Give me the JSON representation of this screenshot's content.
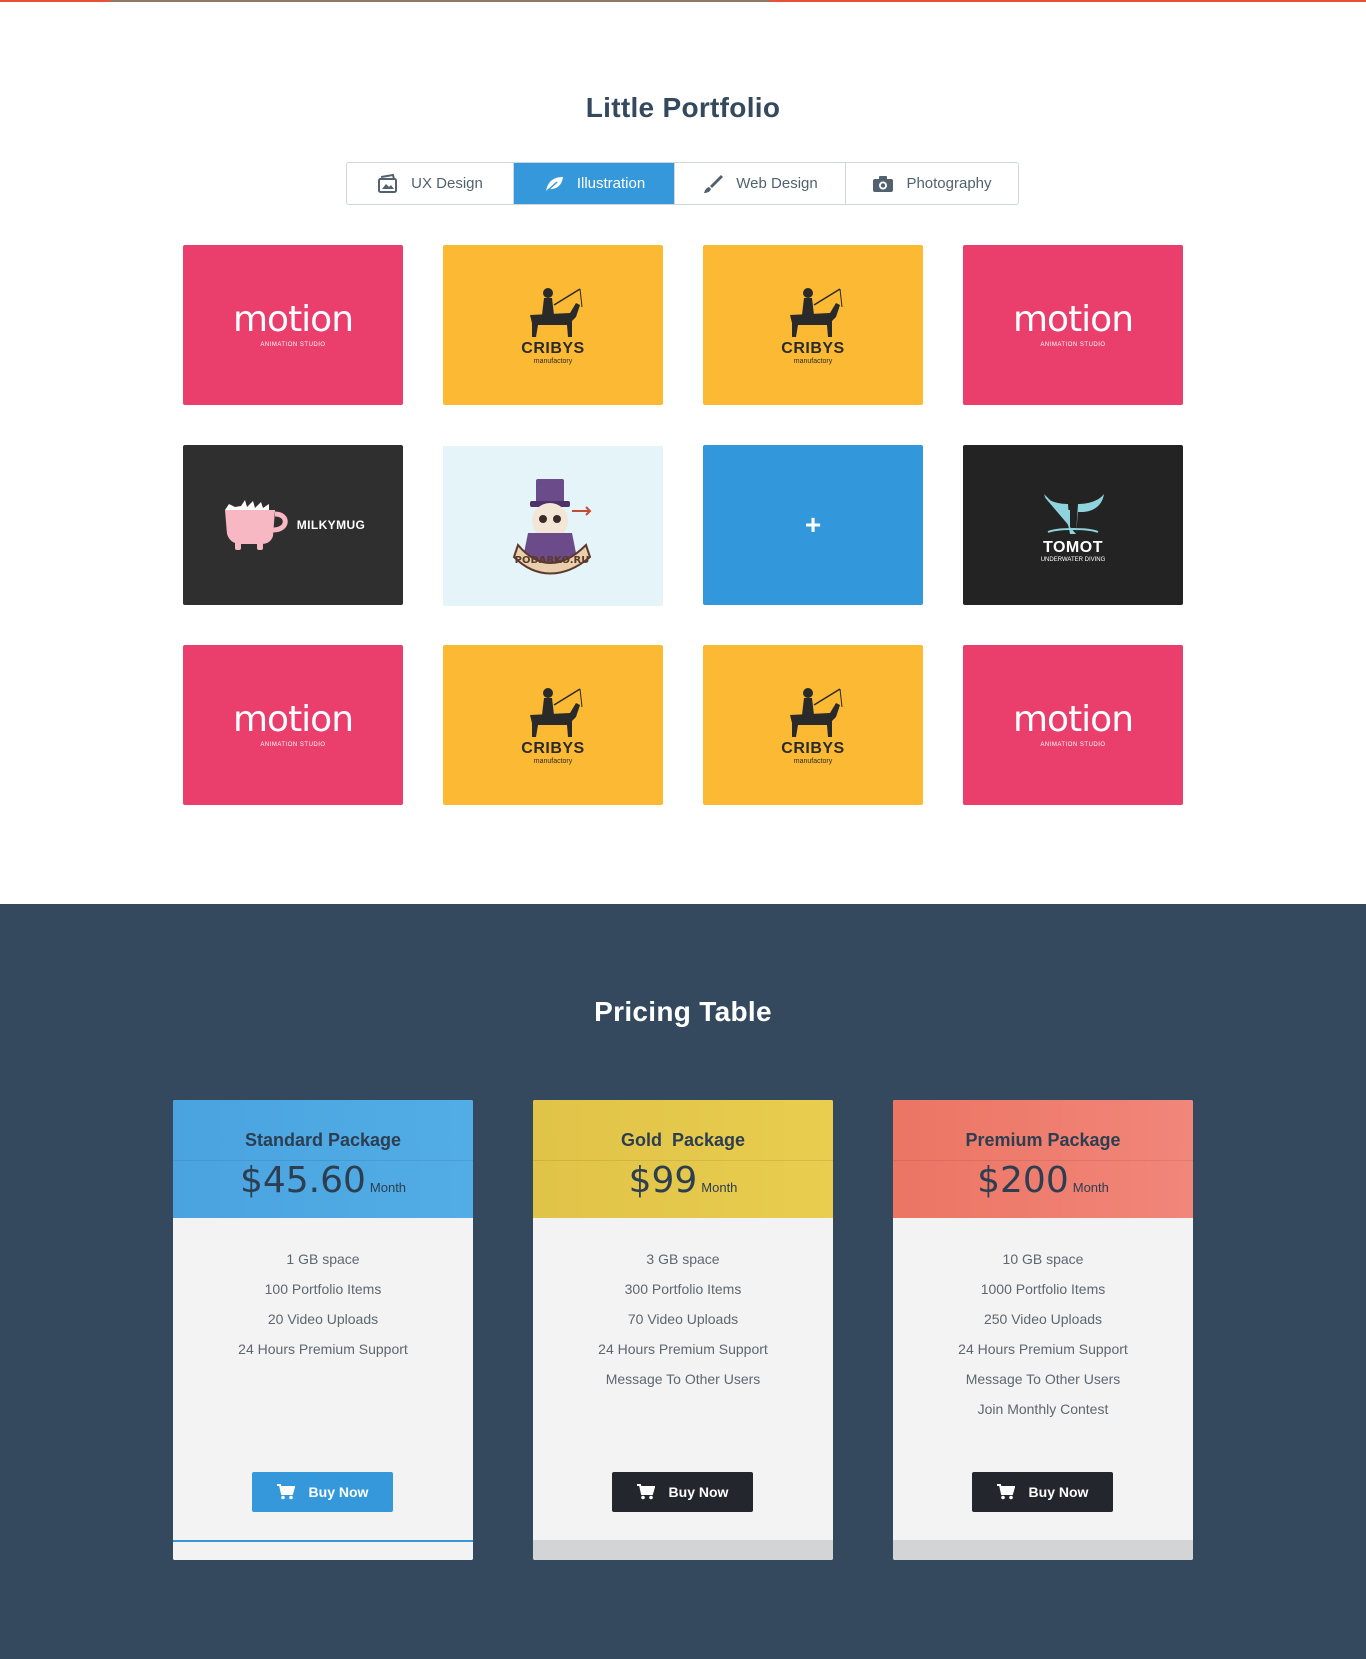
{
  "portfolio": {
    "title": "Little Portfolio",
    "filters": [
      {
        "label": "UX Design",
        "icon": "image-folder-icon",
        "active": false
      },
      {
        "label": "Illustration",
        "icon": "leaf-icon",
        "active": true
      },
      {
        "label": "Web Design",
        "icon": "brush-icon",
        "active": false
      },
      {
        "label": "Photography",
        "icon": "camera-icon",
        "active": false
      }
    ],
    "tiles": [
      {
        "logo": "motion",
        "color": "#ea3e6c"
      },
      {
        "logo": "cribys",
        "color": "#fbb934"
      },
      {
        "logo": "cribys",
        "color": "#fbb934"
      },
      {
        "logo": "motion",
        "color": "#ea3e6c"
      },
      {
        "logo": "milkymug",
        "color": "#2f2f2f"
      },
      {
        "logo": "podarko",
        "color": "#e4f4f9"
      },
      {
        "logo": "plus",
        "color": "#3398db"
      },
      {
        "logo": "tomot",
        "color": "#232323"
      },
      {
        "logo": "motion",
        "color": "#ea3e6c"
      },
      {
        "logo": "cribys",
        "color": "#fbb934"
      },
      {
        "logo": "cribys",
        "color": "#fbb934"
      },
      {
        "logo": "motion",
        "color": "#ea3e6c"
      }
    ],
    "motion": {
      "word": "motion",
      "sub": "ANIMATION STUDIO"
    },
    "cribys": {
      "word": "CRIBYS",
      "sub": "manufactory"
    },
    "milkymug": {
      "word": "MILKYMUG"
    },
    "podarko": {
      "word": "PODARKO.RU"
    },
    "plus": {
      "symbol": "+"
    },
    "tomot": {
      "word": "TOMOT",
      "sub": "UNDERWATER DIVING"
    }
  },
  "pricing": {
    "title": "Pricing Table",
    "packages": [
      {
        "name": "Standard Package",
        "price": "$45.60",
        "period": "Month",
        "header_color": "#4aa3df",
        "button_style": "blue",
        "features": [
          "1 GB space",
          "100 Portfolio Items",
          "20 Video Uploads",
          "24 Hours Premium Support"
        ],
        "button_label": "Buy Now"
      },
      {
        "name": "Gold  Package",
        "price": "$99",
        "period": "Month",
        "header_color": "#e5c84a",
        "button_style": "dark",
        "features": [
          "3 GB space",
          "300 Portfolio Items",
          "70 Video Uploads",
          "24 Hours Premium Support",
          "Message To Other Users"
        ],
        "button_label": "Buy Now"
      },
      {
        "name": "Premium Package",
        "price": "$200",
        "period": "Month",
        "header_color": "#ef7f6f",
        "button_style": "dark",
        "features": [
          "10 GB space",
          "1000 Portfolio Items",
          "250 Video Uploads",
          "24 Hours Premium Support",
          "Message To Other Users",
          "Join Monthly Contest"
        ],
        "button_label": "Buy Now"
      }
    ]
  },
  "colors": {
    "accent": "#3498db",
    "top_strip": "#ea4f3a",
    "pricing_bg": "#34495e"
  }
}
